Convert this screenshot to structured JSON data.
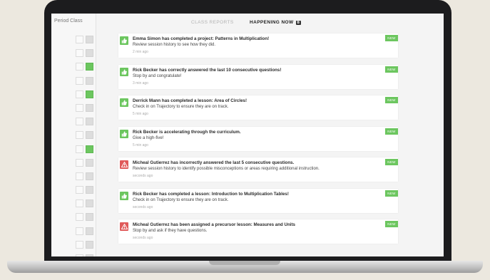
{
  "sidebar": {
    "title": "Period Class",
    "rows": [
      {
        "left": "empty",
        "right": "gray"
      },
      {
        "left": "empty",
        "right": "gray"
      },
      {
        "left": "empty",
        "right": "green"
      },
      {
        "left": "empty",
        "right": "gray"
      },
      {
        "left": "empty",
        "right": "green"
      },
      {
        "left": "empty",
        "right": "gray"
      },
      {
        "left": "empty",
        "right": "gray"
      },
      {
        "left": "empty",
        "right": "gray"
      },
      {
        "left": "empty",
        "right": "green"
      },
      {
        "left": "empty",
        "right": "gray"
      },
      {
        "left": "empty",
        "right": "gray"
      },
      {
        "left": "empty",
        "right": "gray"
      },
      {
        "left": "empty",
        "right": "gray"
      },
      {
        "left": "empty",
        "right": "gray"
      },
      {
        "left": "empty",
        "right": "gray"
      },
      {
        "left": "empty",
        "right": "gray"
      },
      {
        "left": "empty",
        "right": "gray"
      }
    ]
  },
  "tabs": {
    "class_reports": "CLASS REPORTS",
    "happening_now": "HAPPENING NOW",
    "happening_count": "8"
  },
  "colors": {
    "success": "#6cc65f",
    "alert": "#e05a5a"
  },
  "feed": [
    {
      "type": "success",
      "icon": "thumbs-up-icon",
      "title": "Emma Simon has completed a project: Patterns in Multiplication!",
      "message": "Review session history to see how they did.",
      "time": "2 min ago",
      "badge": "NEW"
    },
    {
      "type": "success",
      "icon": "thumbs-up-icon",
      "title": "Rick Becker has correctly answered the last 10 consecutive questions!",
      "message": "Stop by and congratulate!",
      "time": "3 min ago",
      "badge": "NEW"
    },
    {
      "type": "success",
      "icon": "thumbs-up-icon",
      "title": "Derrick Mann has completed a lesson: Area of Circles!",
      "message": "Check in on Trajectory to ensure they are on track.",
      "time": "5 min ago",
      "badge": "NEW"
    },
    {
      "type": "success",
      "icon": "thumbs-up-icon",
      "title": "Rick Becker is accelerating through the curriculum.",
      "message": "Give a high-five!",
      "time": "5 min ago",
      "badge": "NEW"
    },
    {
      "type": "alert",
      "icon": "warning-icon",
      "title": "Micheal Gutierrez has incorrectly answered the last 5 consecutive questions.",
      "message": "Review session history to identify possible misconceptions or areas requiring additional instruction.",
      "time": "seconds ago",
      "badge": "NEW"
    },
    {
      "type": "success",
      "icon": "thumbs-up-icon",
      "title": "Rick Becker has completed a lesson: Introduction to Multiplication Tables!",
      "message": "Check in on Trajectory to ensure they are on track.",
      "time": "seconds ago",
      "badge": "NEW"
    },
    {
      "type": "alert",
      "icon": "warning-icon",
      "title": "Micheal Gutierrez has been assigned a precursor lesson: Measures and Units",
      "message": "Stop by and ask if they have questions.",
      "time": "seconds ago",
      "badge": "NEW"
    }
  ]
}
